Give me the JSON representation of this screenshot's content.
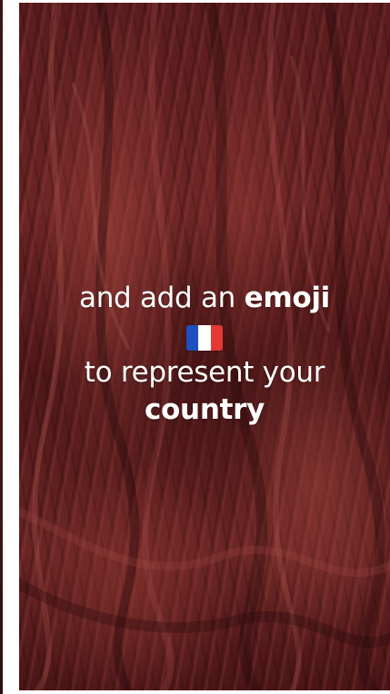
{
  "story": {
    "caption": {
      "line1_normal": "and add an ",
      "line1_bold": "emoji",
      "line3": "to represent your",
      "line4_bold": "country"
    },
    "emoji": {
      "icon": "france-flag-emoji",
      "colors": [
        "#1f4fbf",
        "#ffffff",
        "#e53935"
      ]
    },
    "background": {
      "accent": "#5a1c1e"
    }
  }
}
